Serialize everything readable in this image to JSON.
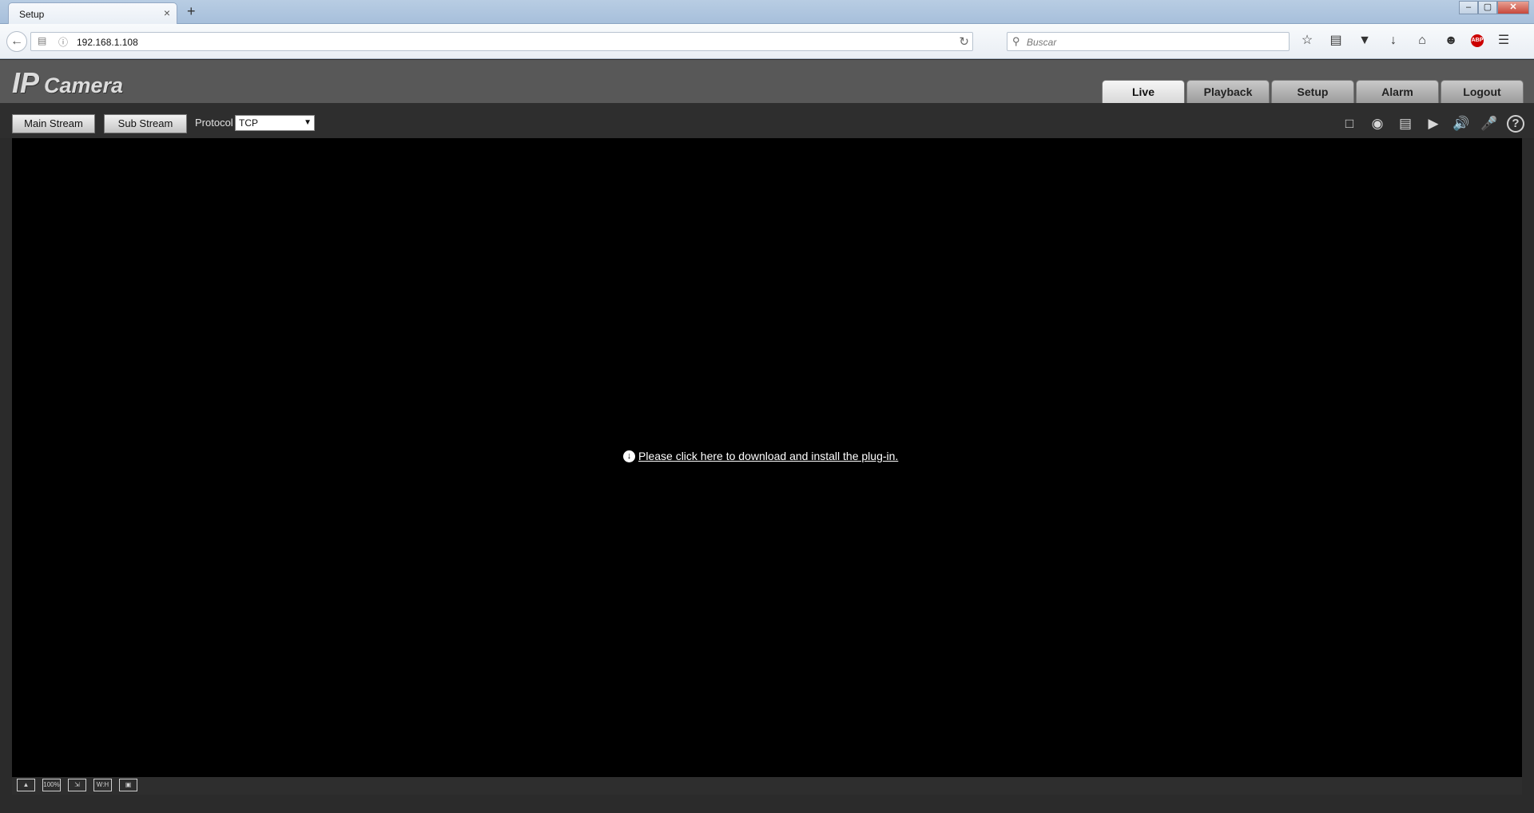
{
  "browser": {
    "tab_title": "Setup",
    "tab_close": "×",
    "new_tab": "+",
    "url": "192.168.1.108",
    "search_placeholder": "Buscar",
    "window_buttons": {
      "minimize": "‒",
      "restore": "▢",
      "close": "✕"
    }
  },
  "camera": {
    "logo_ip": "IP",
    "logo_camera": "Camera",
    "tabs": [
      {
        "label": "Live",
        "active": true
      },
      {
        "label": "Playback",
        "active": false
      },
      {
        "label": "Setup",
        "active": false
      },
      {
        "label": "Alarm",
        "active": false
      },
      {
        "label": "Logout",
        "active": false
      }
    ],
    "controls": {
      "main_stream": "Main Stream",
      "sub_stream": "Sub Stream",
      "protocol_label": "Protocol",
      "protocol_value": "TCP"
    },
    "plugin_message": "Please click here to download and install the plug-in.",
    "bottom_icons": [
      "zoom-icon",
      "100%",
      "fit-icon",
      "W:H",
      "fullscreen-icon"
    ],
    "bottom_labels": {
      "hundred": "100%",
      "wh": "W:H"
    }
  },
  "colors": {
    "video_bg": "#000000",
    "header_bg": "#585858",
    "control_bg": "#2e2e2e"
  }
}
